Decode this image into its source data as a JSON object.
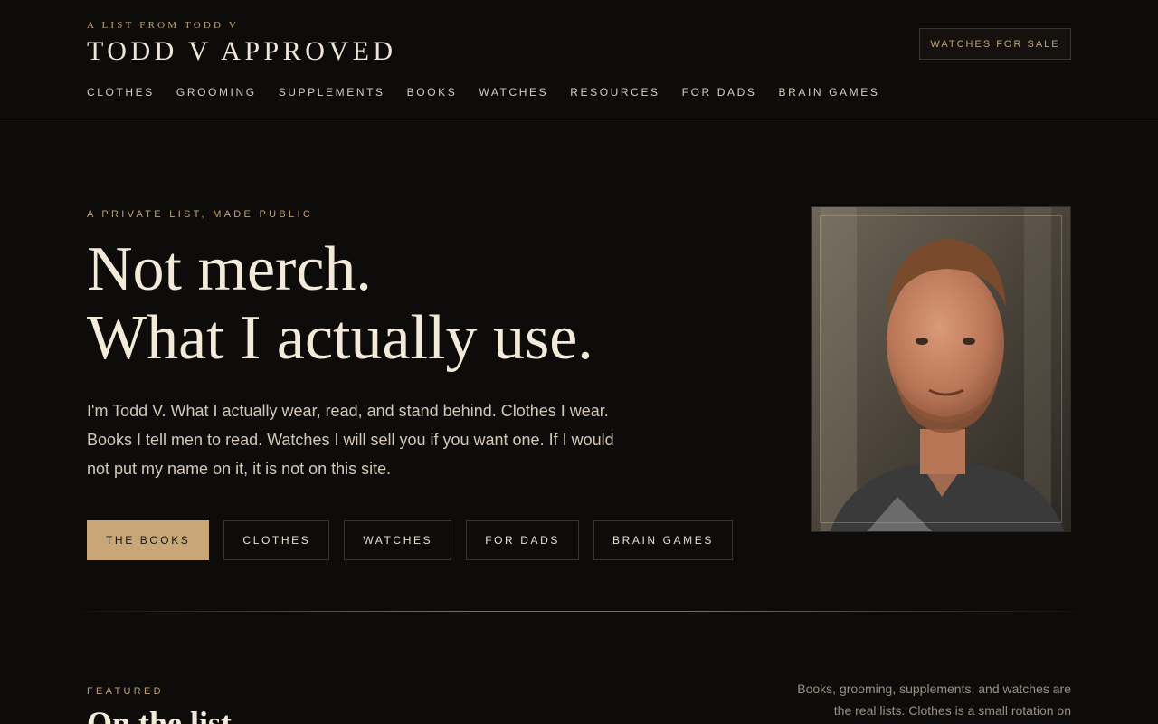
{
  "header": {
    "eyebrow": "A LIST FROM TODD V",
    "brand": "TODD V APPROVED",
    "cta_label": "WATCHES FOR SALE",
    "nav": [
      "CLOTHES",
      "GROOMING",
      "SUPPLEMENTS",
      "BOOKS",
      "WATCHES",
      "RESOURCES",
      "FOR DADS",
      "BRAIN GAMES"
    ]
  },
  "hero": {
    "kicker": "A PRIVATE LIST, MADE PUBLIC",
    "headline_line1": "Not merch.",
    "headline_line2": "What I actually use.",
    "intro": "I'm Todd V. What I actually wear, read, and stand behind. Clothes I wear. Books I tell men to read. Watches I will sell you if you want one. If I would not put my name on it, it is not on this site.",
    "buttons": [
      "THE BOOKS",
      "CLOTHES",
      "WATCHES",
      "FOR DADS",
      "BRAIN GAMES"
    ]
  },
  "featured": {
    "label": "FEATURED",
    "title": "On the list",
    "note": "Books, grooming, supplements, and watches are the real lists. Clothes is a small rotation on"
  },
  "colors": {
    "background": "#0e0c0b",
    "accent_gold": "#c8a675",
    "text_cream": "#f3ead9"
  }
}
